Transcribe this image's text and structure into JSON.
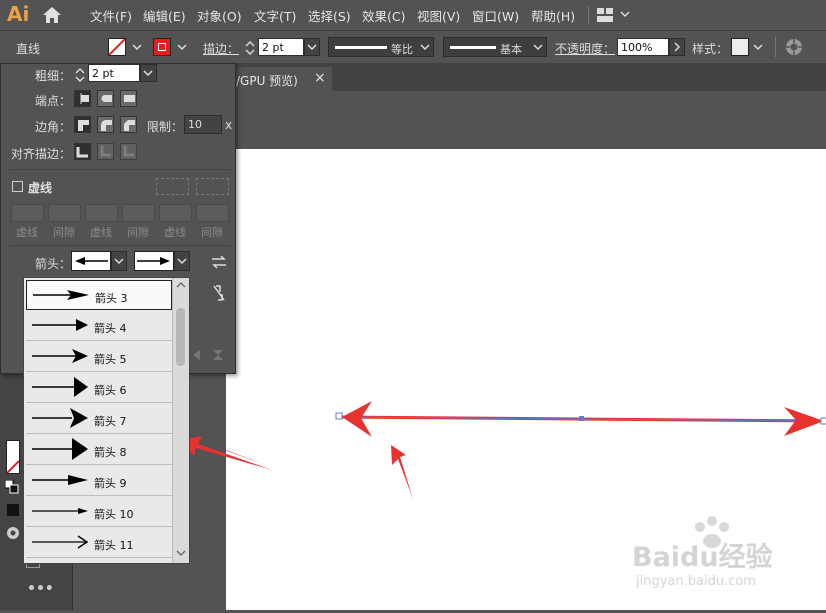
{
  "app": {
    "logo": "Ai"
  },
  "menu": [
    "文件(F)",
    "编辑(E)",
    "对象(O)",
    "文字(T)",
    "选择(S)",
    "效果(C)",
    "视图(V)",
    "窗口(W)",
    "帮助(H)"
  ],
  "control": {
    "selection_label": "直线",
    "stroke_label": "描边：",
    "stroke_weight": "2 pt",
    "profile_label": "等比",
    "brush_label": "基本",
    "opacity_label": "不透明度：",
    "opacity_value": "100%",
    "style_label": "样式："
  },
  "tab": {
    "title": "/GPU 预览)",
    "close": "×"
  },
  "stroke_panel": {
    "weight_label": "粗细：",
    "weight_value": "2 pt",
    "cap_label": "端点：",
    "corner_label": "边角：",
    "limit_label": "限制：",
    "limit_value": "10",
    "limit_unit": "x",
    "align_label": "对齐描边：",
    "dashed_label": "虚线",
    "dash_captions": [
      "虚线",
      "间隙",
      "虚线",
      "间隙",
      "虚线",
      "间隙"
    ],
    "arrow_label": "箭头："
  },
  "arrow_list": [
    "箭头 3",
    "箭头 4",
    "箭头 5",
    "箭头 6",
    "箭头 7",
    "箭头 8",
    "箭头 9",
    "箭头 10",
    "箭头 11"
  ],
  "watermark": {
    "brand": "Baidu经验",
    "url": "jingyan.baidu.com"
  },
  "colors": {
    "accent_red": "#e8322f",
    "path_blue": "#5a7bd8",
    "logo_orange": "#e8a04a"
  }
}
